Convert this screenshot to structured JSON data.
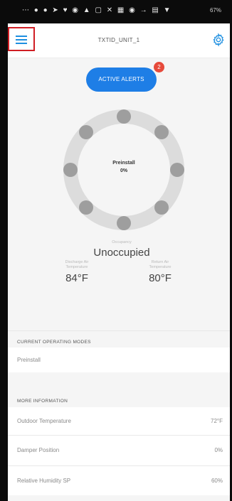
{
  "statusbar": {
    "icons": "⋯ ● ● ➤ ♥ ◉ ▲ ▢ ✕ ▦ ◉ → ▤ ▼",
    "battery": "67%"
  },
  "header": {
    "title": "TXTID_UNIT_1",
    "menu_icon": "hamburger-menu-icon",
    "settings_icon": "gear-icon"
  },
  "alerts": {
    "label": "ACTIVE ALERTS",
    "count": "2"
  },
  "dial": {
    "mode": "Preinstall",
    "percent": "0%"
  },
  "readings": {
    "discharge_label_1": "Discharge Air",
    "discharge_label_2": "Temperature",
    "discharge_value": "84°F",
    "return_label_1": "Return Air",
    "return_label_2": "Temperature",
    "return_value": "80°F"
  },
  "occupancy": {
    "label": "Occupancy",
    "value": "Unoccupied"
  },
  "operating_modes": {
    "header": "CURRENT OPERATING MODES",
    "value": "Preinstall"
  },
  "more_info": {
    "header": "MORE INFORMATION",
    "rows": [
      {
        "label": "Outdoor Temperature",
        "value": "72°F"
      },
      {
        "label": "Damper Position",
        "value": "0%"
      },
      {
        "label": "Relative Humidity SP",
        "value": "60%"
      }
    ]
  },
  "colors": {
    "accent": "#1e7ee6",
    "badge": "#e64a3b",
    "highlight": "#d01e24"
  }
}
